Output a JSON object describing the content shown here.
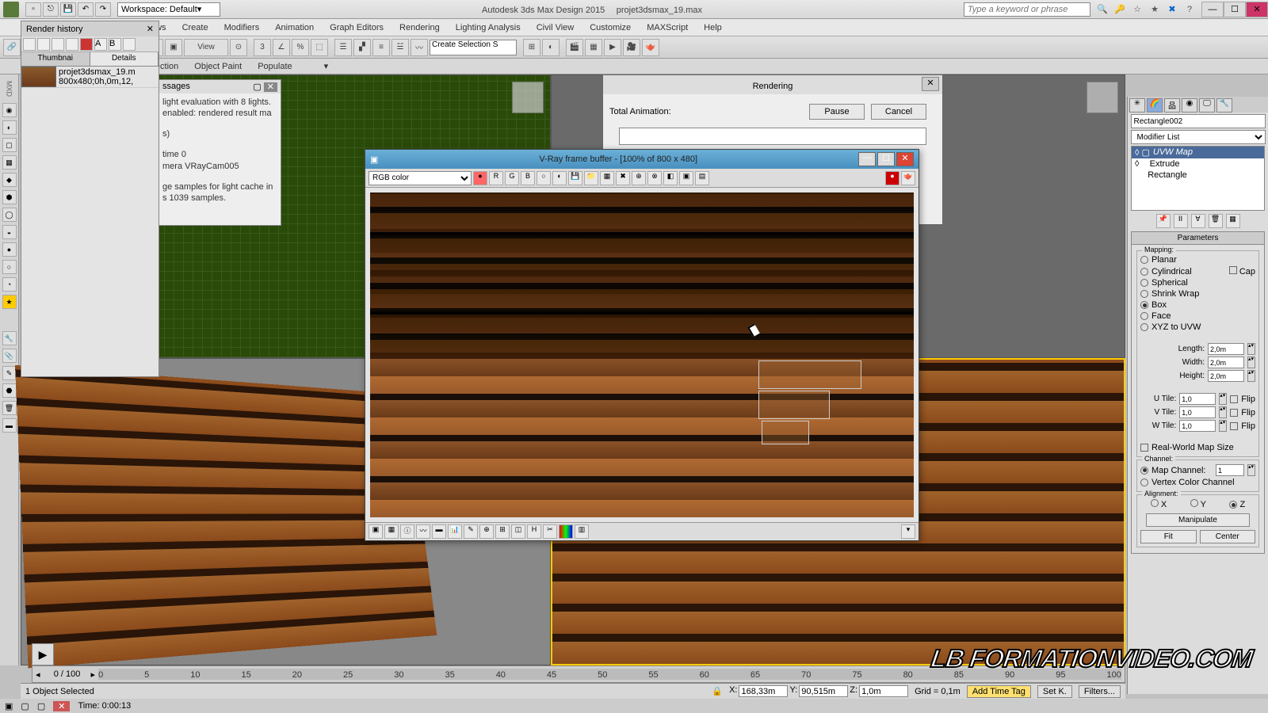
{
  "title": {
    "app": "Autodesk 3ds Max Design 2015",
    "file": "projet3dsmax_19.max"
  },
  "workspace": {
    "label": "Workspace: Default"
  },
  "search": {
    "placeholder": "Type a keyword or phrase"
  },
  "menus": [
    "ews",
    "Create",
    "Modifiers",
    "Animation",
    "Graph Editors",
    "Rendering",
    "Lighting Analysis",
    "Civil View",
    "Customize",
    "MAXScript",
    "Help"
  ],
  "secbar": [
    "Selection",
    "Object Paint",
    "Populate"
  ],
  "render_history": {
    "title": "Render history",
    "tabs": [
      "Thumbnai",
      "Details"
    ],
    "row": {
      "file": "projet3dsmax_19.m",
      "info": "800x480;0h,0m,12,"
    }
  },
  "messages": {
    "title": "ssages",
    "lines": [
      "light evaluation with 8 lights.",
      "enabled: rendered result ma",
      "s)",
      "time 0",
      "mera VRayCam005",
      "ge samples for light cache in",
      "s 1039 samples."
    ]
  },
  "render_dlg": {
    "title": "Rendering",
    "total": "Total Animation:",
    "pause": "Pause",
    "cancel": "Cancel"
  },
  "vfb": {
    "title": "V-Ray frame buffer - [100% of 800 x 480]",
    "channel": "RGB color"
  },
  "cmd": {
    "obj_name": "Rectangle002",
    "modlist_label": "Modifier List",
    "stack": [
      "UVW Map",
      "Extrude",
      "Rectangle"
    ],
    "rollout": "Parameters",
    "mapping": {
      "label": "Mapping:",
      "opts": [
        "Planar",
        "Cylindrical",
        "Spherical",
        "Shrink Wrap",
        "Box",
        "Face",
        "XYZ to UVW"
      ],
      "sel": "Box",
      "cap": "Cap"
    },
    "dims": {
      "length_l": "Length:",
      "length": "2,0m",
      "width_l": "Width:",
      "width": "2,0m",
      "height_l": "Height:",
      "height": "2,0m",
      "utile_l": "U Tile:",
      "utile": "1,0",
      "vtile_l": "V Tile:",
      "vtile": "1,0",
      "wtile_l": "W Tile:",
      "wtile": "1,0",
      "flip": "Flip"
    },
    "realworld": "Real-World Map Size",
    "channel": {
      "label": "Channel:",
      "map_l": "Map Channel:",
      "map": "1",
      "vc": "Vertex Color Channel"
    },
    "align": {
      "label": "Alignment:",
      "x": "X",
      "y": "Y",
      "z": "Z",
      "manip": "Manipulate",
      "fit": "Fit",
      "center": "Center"
    }
  },
  "timeline": {
    "frame": "0 / 100",
    "ticks": [
      "0",
      "5",
      "10",
      "15",
      "20",
      "25",
      "30",
      "35",
      "40",
      "45",
      "50",
      "55",
      "60",
      "65",
      "70",
      "75",
      "80",
      "85",
      "90",
      "95",
      "100"
    ]
  },
  "status": {
    "sel": "1 Object Selected",
    "x_l": "X:",
    "x": "168,33m",
    "y_l": "Y:",
    "y": "90,515m",
    "z_l": "Z:",
    "z": "1,0m",
    "grid": "Grid = 0,1m",
    "tag": "Add Time Tag",
    "time": "Time: 0:00:13",
    "setk": "Set K.",
    "filters": "Filters...",
    "manip": "Manipulate"
  },
  "watermark": "LB FORMATIONVIDEO.COM",
  "toolbar_sel": "Create Selection S",
  "view_drop": "View"
}
